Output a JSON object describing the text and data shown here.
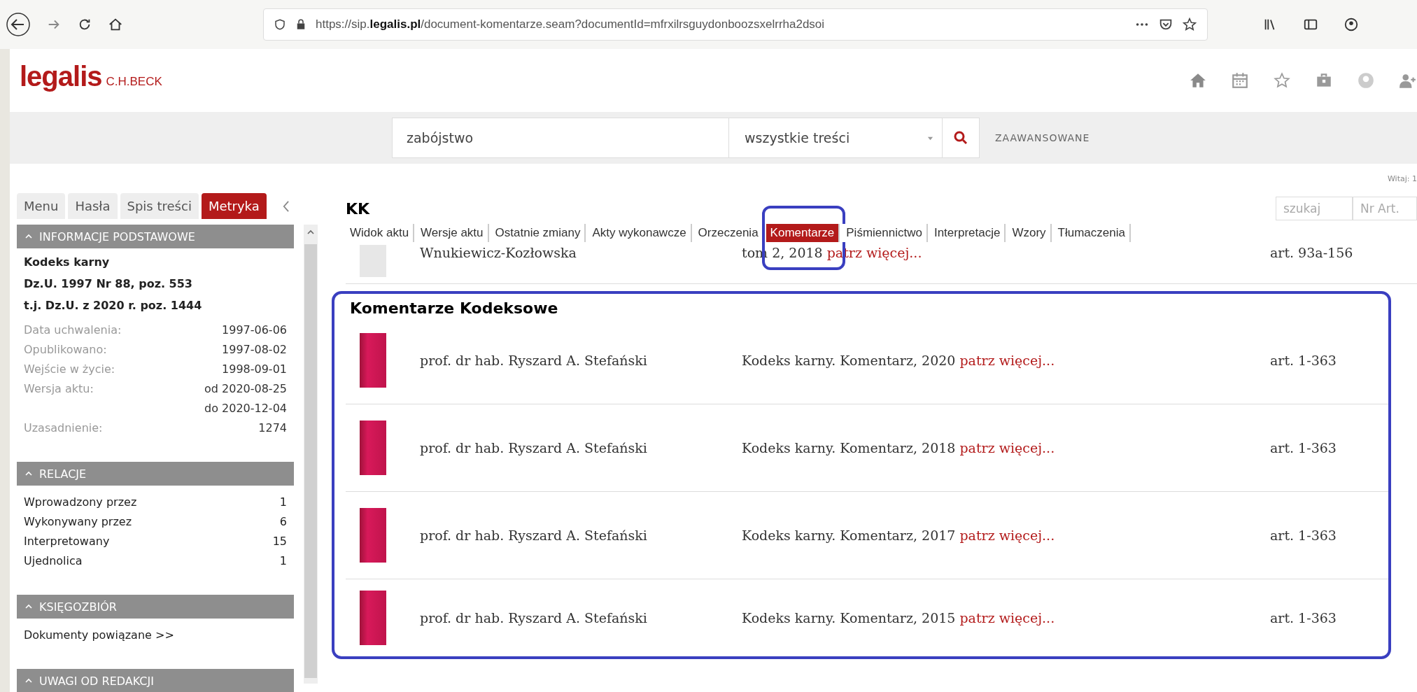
{
  "browser": {
    "url": "https://sip.**legalis.pl**/document-komentarze.seam?documentId=mfrxilrsguydonboozsxelrrha2dsoi"
  },
  "header": {
    "logo": "legalis",
    "publisher": "C.H.BECK"
  },
  "search": {
    "value": "zabójstwo",
    "scope": "wszystkie treści",
    "advanced": "ZAAWANSOWANE"
  },
  "greeting": "Witaj: 1",
  "sidebar": {
    "tabs": [
      {
        "label": "Menu",
        "selected": false
      },
      {
        "label": "Hasła",
        "selected": false
      },
      {
        "label": "Spis treści",
        "selected": false
      },
      {
        "label": "Metryka",
        "selected": true
      }
    ],
    "sections": [
      {
        "title": "INFORMACJE PODSTAWOWE",
        "expanded": true,
        "kind": "info",
        "headings": [
          "Kodeks karny",
          "Dz.U. 1997 Nr 88, poz. 553",
          "t.j. Dz.U. z 2020 r. poz. 1444"
        ],
        "fields": [
          {
            "label": "Data uchwalenia:",
            "values": [
              "1997-06-06"
            ]
          },
          {
            "label": "Opublikowano:",
            "values": [
              "1997-08-02"
            ]
          },
          {
            "label": "Wejście w życie:",
            "values": [
              "1998-09-01"
            ]
          },
          {
            "label": "Wersja aktu:",
            "values": [
              "od 2020-08-25",
              "do 2020-12-04"
            ]
          },
          {
            "label": "Uzasadnienie:",
            "values": [
              "1274"
            ]
          }
        ]
      },
      {
        "title": "RELACJE",
        "expanded": true,
        "kind": "relations",
        "items": [
          {
            "label": "Wprowadzony przez",
            "count": "1"
          },
          {
            "label": "Wykonywany przez",
            "count": "6"
          },
          {
            "label": "Interpretowany",
            "count": "15"
          },
          {
            "label": "Ujednolica",
            "count": "1"
          }
        ]
      },
      {
        "title": "KSIĘGOZBIÓR",
        "expanded": true,
        "kind": "links",
        "links": [
          "Dokumenty powiązane >>"
        ]
      },
      {
        "title": "UWAGI OD REDAKCJI",
        "expanded": true,
        "kind": "empty"
      }
    ]
  },
  "document": {
    "title": "KK",
    "search_placeholder": "szukaj",
    "article_placeholder": "Nr Art.",
    "tabs": [
      {
        "label": "Widok aktu",
        "selected": false,
        "highlighted": false
      },
      {
        "label": "Wersje aktu",
        "selected": false,
        "highlighted": false
      },
      {
        "label": "Ostatnie zmiany",
        "selected": false,
        "highlighted": false
      },
      {
        "label": "Akty wykonawcze",
        "selected": false,
        "highlighted": false
      },
      {
        "label": "Orzeczenia",
        "selected": false,
        "highlighted": false
      },
      {
        "label": "Komentarze",
        "selected": true,
        "highlighted": true
      },
      {
        "label": "Piśmiennictwo",
        "selected": false,
        "highlighted": false
      },
      {
        "label": "Interpretacje",
        "selected": false,
        "highlighted": false
      },
      {
        "label": "Wzory",
        "selected": false,
        "highlighted": false
      },
      {
        "label": "Tłumaczenia",
        "selected": false,
        "highlighted": false
      }
    ],
    "partial_row": {
      "author": "Wnukiewicz-Kozłowska",
      "title": "tom 2, 2018",
      "more": "patrz więcej...",
      "articles": "art. 93a-156"
    },
    "section": {
      "heading": "Komentarze Kodeksowe",
      "highlighted": true,
      "rows": [
        {
          "author": "prof. dr hab. Ryszard A. Stefański",
          "title": "Kodeks karny. Komentarz, 2020",
          "more": "patrz więcej...",
          "articles": "art. 1-363"
        },
        {
          "author": "prof. dr hab. Ryszard A. Stefański",
          "title": "Kodeks karny. Komentarz, 2018",
          "more": "patrz więcej...",
          "articles": "art. 1-363"
        },
        {
          "author": "prof. dr hab. Ryszard A. Stefański",
          "title": "Kodeks karny. Komentarz, 2017",
          "more": "patrz więcej...",
          "articles": "art. 1-363"
        },
        {
          "author": "prof. dr hab. Ryszard A. Stefański",
          "title": "Kodeks karny. Komentarz, 2015",
          "more": "patrz więcej...",
          "articles": "art. 1-363"
        }
      ]
    }
  }
}
